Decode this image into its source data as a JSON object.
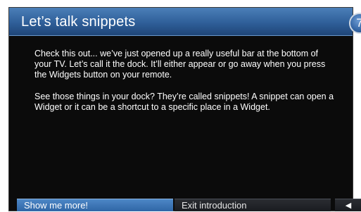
{
  "dialog": {
    "title": "Let’s talk snippets",
    "step_number": "7",
    "paragraphs": [
      "Check this out... we’ve just opened up a really useful bar at the bottom of your TV. Let’s call it the dock. It’ll either appear or go away when you press the Widgets button on your remote.",
      "See those things in your dock? They’re called snippets! A snippet can open a Widget or it can be a shortcut to a specific place in a Widget."
    ]
  },
  "footer": {
    "primary_label": "Show me more!",
    "secondary_label": "Exit introduction",
    "back_icon": "left-arrow-icon",
    "back_glyph": "◀"
  },
  "colors": {
    "header_blue": "#2f5f99",
    "button_blue": "#3a74b6",
    "background": "#0b0b0b"
  }
}
